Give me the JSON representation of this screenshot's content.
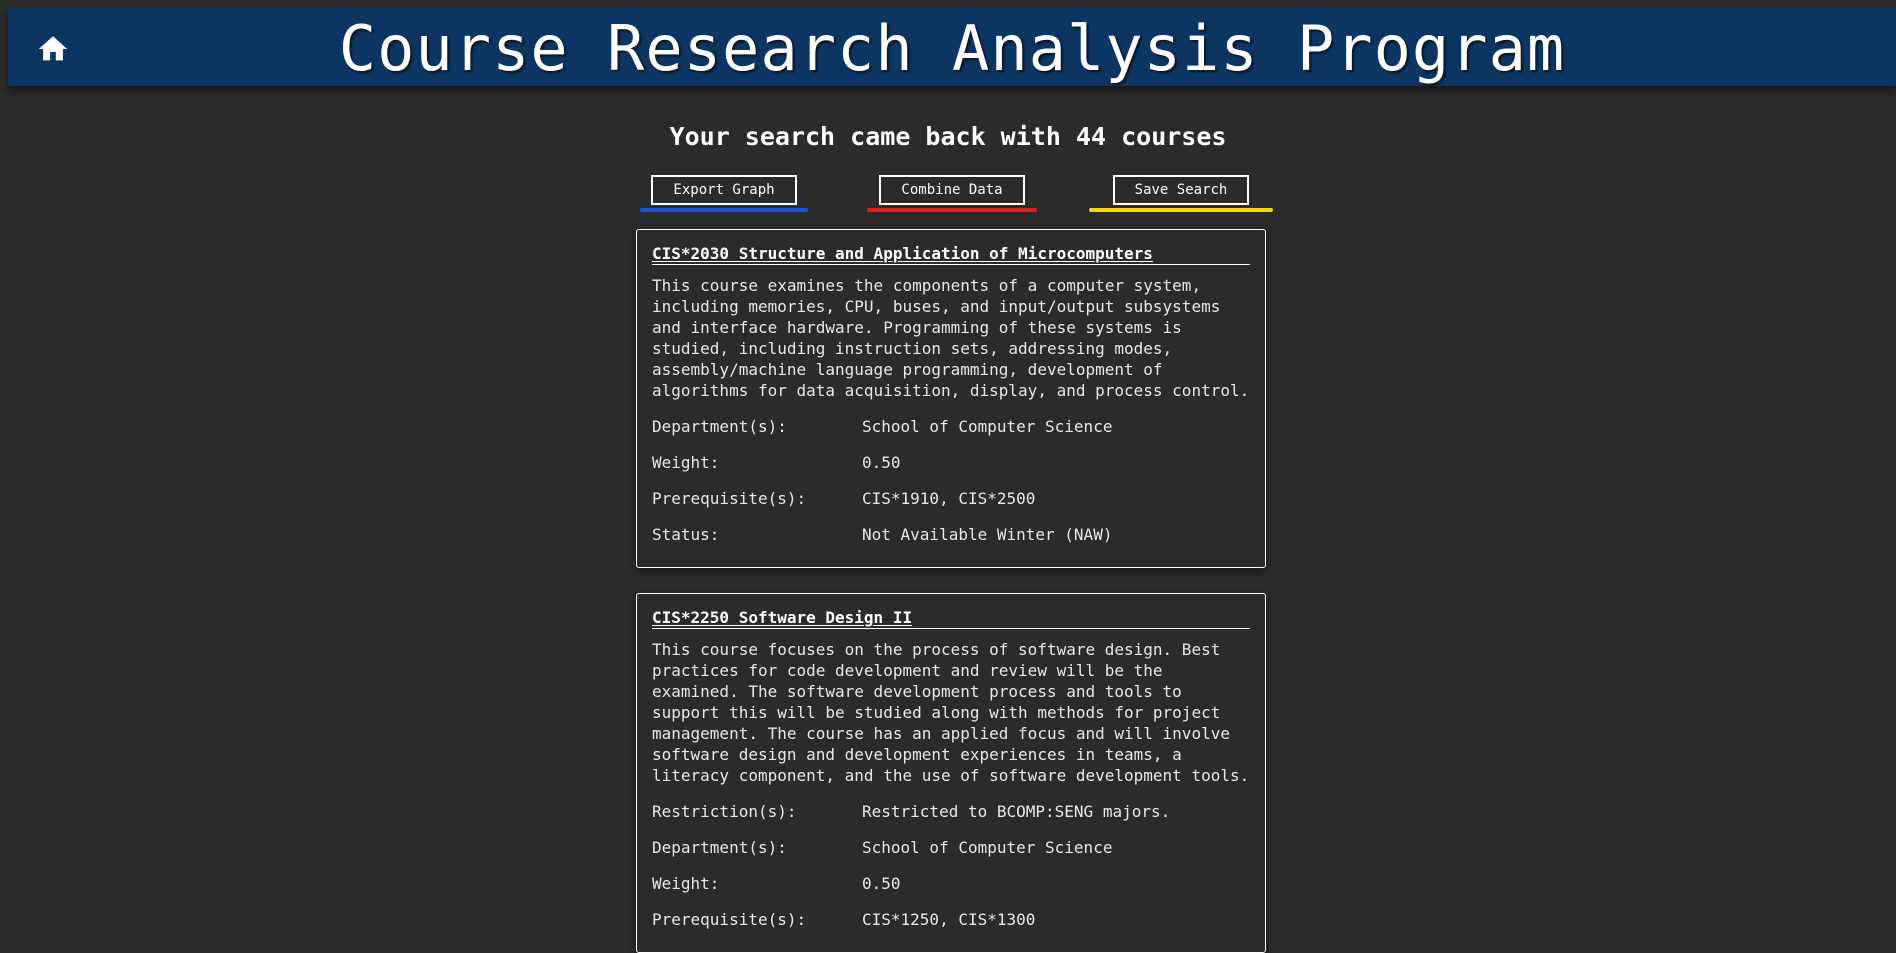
{
  "header": {
    "title": "Course Research Analysis Program"
  },
  "results": {
    "heading": "Your search came back with 44 courses"
  },
  "actions": [
    {
      "label": "Export Graph",
      "color": "#1f4fd6"
    },
    {
      "label": "Combine Data",
      "color": "#e02020"
    },
    {
      "label": "Save Search",
      "color": "#f5d90a"
    }
  ],
  "courses": [
    {
      "title": "CIS*2030 Structure and Application of Microcomputers",
      "description": "This course examines the components of a computer system,\nincluding memories, CPU, buses, and input/output subsystems\nand interface hardware. Programming of these systems is\nstudied, including instruction sets, addressing modes,\nassembly/machine language programming, development of\nalgorithms for data acquisition, display, and process control.",
      "fields": [
        {
          "label": "Department(s):",
          "value": "School of Computer Science"
        },
        {
          "label": "Weight:",
          "value": "0.50"
        },
        {
          "label": "Prerequisite(s):",
          "value": "CIS*1910, CIS*2500"
        },
        {
          "label": "Status:",
          "value": "Not Available Winter (NAW)"
        }
      ]
    },
    {
      "title": "CIS*2250 Software Design II",
      "description": "This course focuses on the process of software design. Best\npractices for code development and review will be the\nexamined. The software development process and tools to\nsupport this will be studied along with methods for project\nmanagement. The course has an applied focus and will involve\nsoftware design and development experiences in teams, a\nliteracy component, and the use of software development tools.",
      "fields": [
        {
          "label": "Restriction(s):",
          "value": "Restricted to BCOMP:SENG majors."
        },
        {
          "label": "Department(s):",
          "value": "School of Computer Science"
        },
        {
          "label": "Weight:",
          "value": "0.50"
        },
        {
          "label": "Prerequisite(s):",
          "value": "CIS*1250, CIS*1300"
        }
      ]
    }
  ]
}
